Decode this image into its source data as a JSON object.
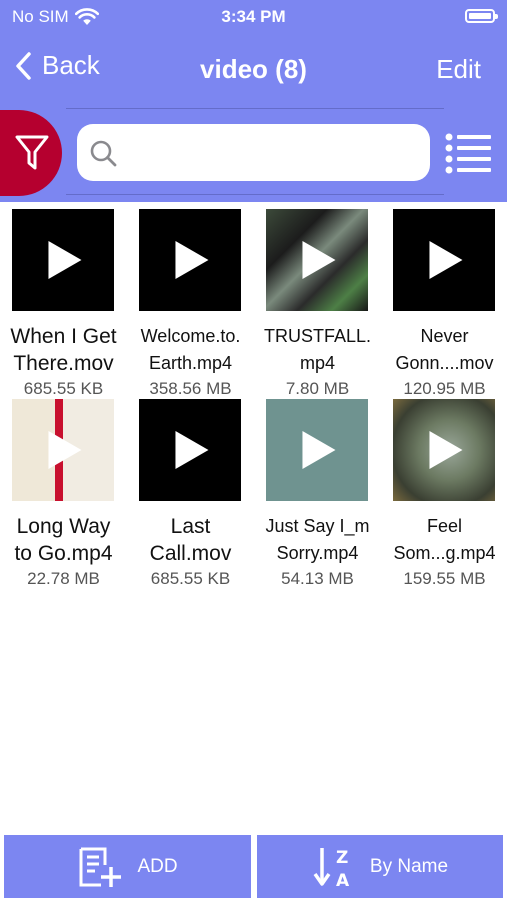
{
  "status": {
    "carrier": "No SIM",
    "time": "3:34 PM"
  },
  "nav": {
    "back_label": "Back",
    "title": "video (8)",
    "edit_label": "Edit"
  },
  "search": {
    "placeholder": "",
    "value": ""
  },
  "icons": {
    "filter": "filter-funnel-icon",
    "search": "search-icon",
    "list": "list-view-icon",
    "play": "play-icon",
    "add": "add-document-icon",
    "sort": "sort-z-a-icon",
    "back": "chevron-left-icon",
    "wifi": "wifi-icon",
    "battery": "battery-icon"
  },
  "colors": {
    "accent": "#7c86f1",
    "filter": "#b5002f",
    "thumb_dark": "#000000"
  },
  "files": [
    {
      "name": "When I Get\nThere.mov",
      "size": "685.55 KB"
    },
    {
      "name": "Welcome.to.\nEarth.mp4",
      "size": "358.56 MB"
    },
    {
      "name": "TRUSTFALL.\nmp4",
      "size": "7.80 MB"
    },
    {
      "name": "Never\nGonn....mov",
      "size": "120.95 MB"
    },
    {
      "name": "Long Way\nto Go.mp4",
      "size": "22.78 MB"
    },
    {
      "name": "Last\nCall.mov",
      "size": "685.55 KB"
    },
    {
      "name": "Just Say I_m\nSorry.mp4",
      "size": "54.13 MB"
    },
    {
      "name": "Feel\nSom...g.mp4",
      "size": "159.55 MB"
    }
  ],
  "bottom": {
    "add_label": "ADD",
    "sort_label": "By Name"
  }
}
